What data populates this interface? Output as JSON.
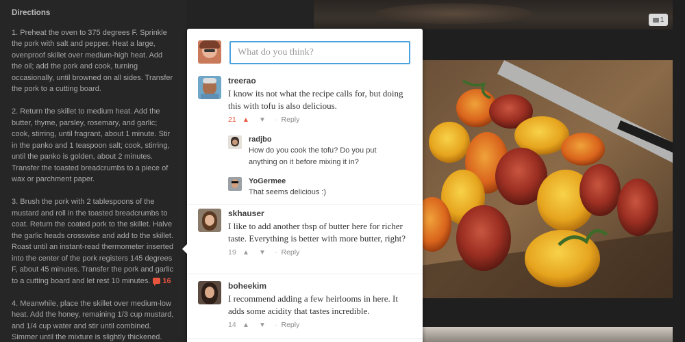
{
  "directions": {
    "heading": "Directions",
    "steps": [
      "1. Preheat the oven to 375 degrees F. Sprinkle the pork with salt and pepper. Heat a large, ovenproof skillet over medium-high heat. Add the oil; add the pork and cook, turning occasionally, until browned on all sides. Transfer the pork to a cutting board.",
      "2. Return the skillet to medium heat. Add the butter, thyme, parsley, rosemary, and garlic; cook, stirring, until fragrant, about 1 minute. Stir in the panko and 1 teaspoon salt; cook, stirring, until the panko is golden, about 2 minutes. Transfer the toasted breadcrumbs to a piece of wax or parchment paper.",
      "3. Brush the pork with 2 tablespoons of the mustard and roll in the toasted breadcrumbs to coat. Return the coated pork to the skillet. Halve the garlic heads crosswise and add to the skillet. Roast until an instant-read thermometer inserted into the center of the pork registers 145 degrees F, about 45 minutes. Transfer the pork and garlic to a cutting board and let rest 10 minutes.",
      "4. Meanwhile, place the skillet over medium-low heat. Add the honey, remaining 1/3 cup mustard, and 1/4 cup water and stir until combined. Simmer until the mixture is slightly thickened."
    ],
    "step3_comment_count": "16"
  },
  "photos": {
    "top_photo_comment_count": "1"
  },
  "popup": {
    "input_placeholder": "What do you think?",
    "reply_label": "Reply",
    "comments": [
      {
        "user": "treerao",
        "text": "I know its not what the recipe calls for, but doing this with tofu is also delicious.",
        "votes": "21",
        "replies": [
          {
            "user": "radjbo",
            "text": "How do you cook the tofu? Do you put anything on it before mixing it in?"
          },
          {
            "user": "YoGermee",
            "text": "That seems delicious :)"
          }
        ]
      },
      {
        "user": "skhauser",
        "text": "I like to add another tbsp of butter here for richer taste. Everything is better with more butter, right?",
        "votes": "19"
      },
      {
        "user": "boheekim",
        "text": "I recommend adding a few heirlooms in here. It adds some acidity that tastes incredible.",
        "votes": "14"
      }
    ]
  },
  "colors": {
    "accent": "#e8553e",
    "input_border": "#4aa3df",
    "background": "#232323"
  }
}
